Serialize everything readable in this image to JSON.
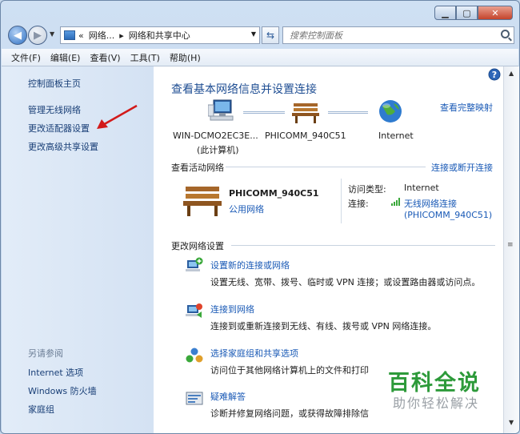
{
  "nav": {
    "breadcrumbs": [
      "«",
      "网络...",
      "▸",
      "网络和共享中心"
    ],
    "search_placeholder": "搜索控制面板"
  },
  "menu": [
    "文件(F)",
    "编辑(E)",
    "查看(V)",
    "工具(T)",
    "帮助(H)"
  ],
  "sidebar": {
    "home": "控制面板主页",
    "links": [
      "管理无线网络",
      "更改适配器设置",
      "更改高级共享设置"
    ],
    "see_also_title": "另请参阅",
    "see_also": [
      "Internet 选项",
      "Windows 防火墙",
      "家庭组"
    ]
  },
  "main": {
    "title": "查看基本网络信息并设置连接",
    "view_full_map": "查看完整映射",
    "map_nodes": [
      {
        "name": "WIN-DCMO2EC3E...",
        "sub": "(此计算机)"
      },
      {
        "name": "PHICOMM_940C51",
        "sub": ""
      },
      {
        "name": "Internet",
        "sub": ""
      }
    ],
    "active_title": "查看活动网络",
    "connect_disconnect": "连接或断开连接",
    "network_name": "PHICOMM_940C51",
    "network_type": "公用网络",
    "access_type_label": "访问类型:",
    "access_type_value": "Internet",
    "connection_label": "连接:",
    "connection_value": "无线网络连接",
    "connection_ssid": "(PHICOMM_940C51)",
    "change_title": "更改网络设置",
    "tasks": [
      {
        "title": "设置新的连接或网络",
        "desc": "设置无线、宽带、拨号、临时或 VPN 连接；或设置路由器或访问点。"
      },
      {
        "title": "连接到网络",
        "desc": "连接到或重新连接到无线、有线、拨号或 VPN 网络连接。"
      },
      {
        "title": "选择家庭组和共享选项",
        "desc": "访问位于其他网络计算机上的文件和打印"
      },
      {
        "title": "疑难解答",
        "desc": "诊断并修复网络问题，或获得故障排除信"
      }
    ]
  },
  "watermark": {
    "main": "百科全说",
    "sub": "助你轻松解决"
  }
}
